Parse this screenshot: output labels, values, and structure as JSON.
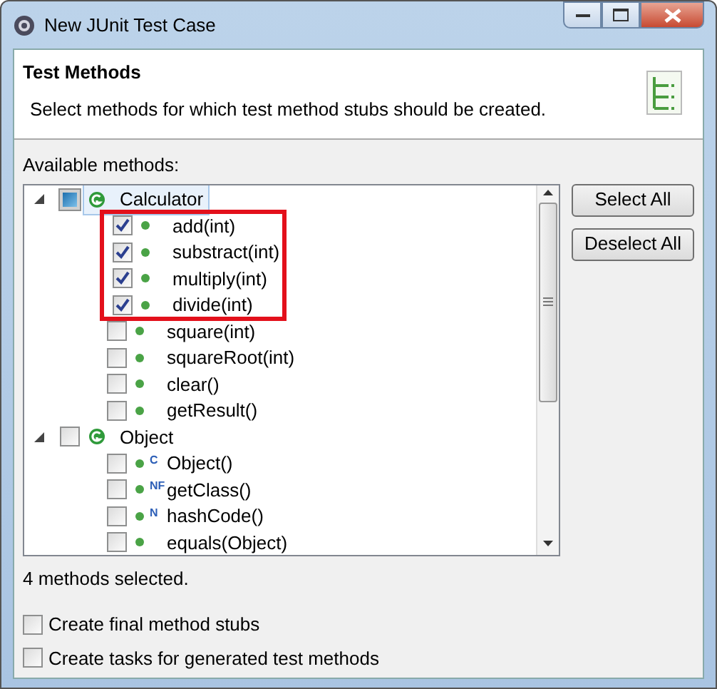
{
  "window": {
    "title": "New JUnit Test Case"
  },
  "header": {
    "title": "Test Methods",
    "description": "Select methods for which test method stubs should be created."
  },
  "methods_label": "Available methods:",
  "tree": [
    {
      "name": "Calculator",
      "expanded": true,
      "checked": false,
      "mixed": true,
      "selected": true,
      "children": [
        {
          "name": "add(int)",
          "checked": true,
          "highlighted": true
        },
        {
          "name": "substract(int)",
          "checked": true,
          "highlighted": true
        },
        {
          "name": "multiply(int)",
          "checked": true,
          "highlighted": true
        },
        {
          "name": "divide(int)",
          "checked": true,
          "highlighted": true
        },
        {
          "name": "square(int)",
          "checked": false,
          "highlighted": false
        },
        {
          "name": "squareRoot(int)",
          "checked": false,
          "highlighted": false
        },
        {
          "name": "clear()",
          "checked": false,
          "highlighted": false
        },
        {
          "name": "getResult()",
          "checked": false,
          "highlighted": false
        }
      ]
    },
    {
      "name": "Object",
      "expanded": true,
      "checked": false,
      "mixed": false,
      "selected": false,
      "children": [
        {
          "name": "Object()",
          "checked": false,
          "highlighted": false,
          "modifier": "C"
        },
        {
          "name": "getClass()",
          "checked": false,
          "highlighted": false,
          "modifier": "NF"
        },
        {
          "name": "hashCode()",
          "checked": false,
          "highlighted": false,
          "modifier": "N"
        },
        {
          "name": "equals(Object)",
          "checked": false,
          "highlighted": false
        }
      ]
    }
  ],
  "side_buttons": [
    "Select All",
    "Deselect All"
  ],
  "status": "4 methods selected.",
  "options": [
    {
      "label": "Create final method stubs",
      "checked": false
    },
    {
      "label": "Create tasks for generated test methods",
      "checked": false
    }
  ]
}
